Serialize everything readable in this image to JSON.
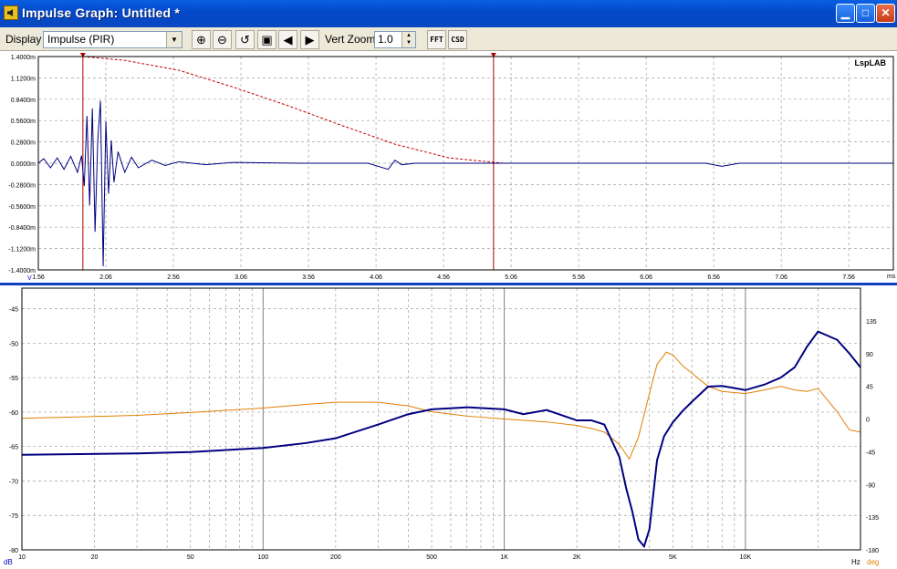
{
  "window": {
    "title": "Impulse Graph: Untitled *",
    "minimize_glyph": "▁",
    "maximize_glyph": "□",
    "close_glyph": "✕"
  },
  "toolbar": {
    "display_label": "Display",
    "display_value": "Impulse (PIR)",
    "display_arrow": "▼",
    "zoom_in_glyph": "⊕",
    "zoom_out_glyph": "⊖",
    "zoom_reset_glyph": "↺",
    "zoom_box_glyph": "▣",
    "prev_glyph": "◀",
    "next_glyph": "▶",
    "vert_zoom_label": "Vert Zoom",
    "vert_zoom_value": "1.0",
    "spin_up": "▲",
    "spin_down": "▼",
    "fft_label": "FFT",
    "csd_label": "CSD"
  },
  "impulse_graph": {
    "logo": "LspLAB",
    "y_ticks": [
      "1.4000m",
      "1.1200m",
      "0.8400m",
      "0.5600m",
      "0.2800m",
      "0.0000m",
      "-0.2800m",
      "-0.5600m",
      "-0.8400m",
      "-1.1200m",
      "-1.4000m"
    ],
    "x_ticks": [
      "1.56",
      "2.06",
      "2.56",
      "3.06",
      "3.56",
      "4.06",
      "4.56",
      "5.06",
      "5.56",
      "6.06",
      "6.56",
      "7.06",
      "7.56"
    ],
    "x_unit": "ms",
    "y_unit": "V",
    "colors": {
      "trace": "#000080",
      "markers": "#b00000",
      "window": "#c00000",
      "grid": "#a0a0a0"
    }
  },
  "frequency_graph": {
    "left_ticks": [
      "-45",
      "-50",
      "-55",
      "-60",
      "-65",
      "-70",
      "-75",
      "-80"
    ],
    "right_ticks": [
      "135",
      "90",
      "45",
      "0",
      "-45",
      "-90",
      "-135",
      "-180"
    ],
    "x_ticks": [
      "10",
      "20",
      "50",
      "100",
      "200",
      "500",
      "1K",
      "2K",
      "5K",
      "10K"
    ],
    "x_unit": "Hz",
    "left_unit": "dB",
    "right_unit": "deg",
    "colors": {
      "magnitude": "#000080",
      "phase": "#e08000",
      "grid": "#a0a0a0"
    }
  },
  "chart_data": [
    {
      "type": "line",
      "xlabel": "ms",
      "ylabel": "V",
      "xlim": [
        1.56,
        7.89
      ],
      "ylim": [
        -1.4,
        1.4
      ],
      "grid": true,
      "series": [
        {
          "x": [
            1.56,
            1.6,
            1.65,
            1.7,
            1.75,
            1.8,
            1.85,
            1.88,
            1.9,
            1.92,
            1.94,
            1.96,
            1.98,
            2.0,
            2.02,
            2.04,
            2.06,
            2.08,
            2.1,
            2.12,
            2.15,
            2.2,
            2.25,
            2.3,
            2.4,
            2.5,
            2.6,
            2.8,
            3.0,
            3.5,
            4.0,
            4.15,
            4.2,
            4.25,
            4.35,
            4.5,
            5.0,
            5.5,
            6.0,
            6.5,
            6.62,
            6.75,
            7.0,
            7.5,
            7.89
          ],
          "y": [
            0.0,
            0.06,
            -0.06,
            0.07,
            -0.08,
            0.09,
            -0.12,
            0.1,
            -0.3,
            0.62,
            -0.55,
            0.72,
            -0.9,
            0.3,
            0.82,
            -1.35,
            0.55,
            -0.4,
            0.3,
            -0.25,
            0.15,
            -0.12,
            0.08,
            -0.06,
            0.04,
            -0.03,
            0.02,
            -0.02,
            0.01,
            0.0,
            0.0,
            -0.08,
            0.04,
            -0.02,
            0.0,
            0.0,
            0.0,
            0.0,
            0.0,
            0.0,
            -0.04,
            0.0,
            0.0,
            0.0,
            0.0
          ]
        },
        {
          "x": [
            1.89,
            2.2,
            2.6,
            3.0,
            3.4,
            3.8,
            4.2,
            4.6,
            5.0
          ],
          "y": [
            1.4,
            1.35,
            1.22,
            1.0,
            0.76,
            0.5,
            0.25,
            0.07,
            0.0
          ]
        }
      ],
      "markers_x": [
        1.89,
        4.93
      ]
    },
    {
      "type": "line",
      "xlabel": "Hz",
      "ylabel": "dB",
      "y2label": "deg",
      "xscale": "log",
      "xlim": [
        10,
        30000
      ],
      "ylim": [
        -80,
        -42
      ],
      "y2lim": [
        -180,
        180
      ],
      "grid": true,
      "series": [
        {
          "x": [
            10,
            30,
            50,
            100,
            150,
            200,
            300,
            400,
            500,
            700,
            1000,
            1200,
            1500,
            2000,
            2300,
            2600,
            3000,
            3200,
            3400,
            3600,
            3800,
            4000,
            4300,
            4600,
            5000,
            5500,
            6000,
            7000,
            8000,
            10000,
            12000,
            14000,
            16000,
            18000,
            20000,
            24000,
            27000,
            30000
          ],
          "y": [
            -66.2,
            -66.0,
            -65.8,
            -65.2,
            -64.5,
            -63.8,
            -61.8,
            -60.3,
            -59.6,
            -59.3,
            -59.6,
            -60.3,
            -59.7,
            -61.2,
            -61.2,
            -61.8,
            -66.5,
            -71.0,
            -74.5,
            -78.5,
            -79.5,
            -77.0,
            -67.0,
            -63.5,
            -61.5,
            -59.8,
            -58.5,
            -56.3,
            -56.2,
            -56.8,
            -56.0,
            -55.0,
            -53.5,
            -50.5,
            -48.3,
            -49.5,
            -51.5,
            -53.5
          ]
        },
        {
          "x": [
            10,
            30,
            50,
            100,
            150,
            200,
            300,
            400,
            500,
            700,
            1000,
            1500,
            2000,
            2300,
            2600,
            3000,
            3300,
            3600,
            4000,
            4300,
            4700,
            5000,
            5500,
            6000,
            7000,
            8000,
            10000,
            12000,
            14000,
            16000,
            18000,
            20000,
            24000,
            27000,
            30000
          ],
          "y": [
            1,
            5,
            9,
            15,
            20,
            23,
            23,
            18,
            10,
            4,
            0,
            -4,
            -9,
            -13,
            -18,
            -35,
            -55,
            -25,
            35,
            75,
            92,
            88,
            73,
            63,
            45,
            38,
            35,
            40,
            45,
            40,
            38,
            42,
            10,
            -15,
            -18
          ]
        }
      ]
    }
  ]
}
